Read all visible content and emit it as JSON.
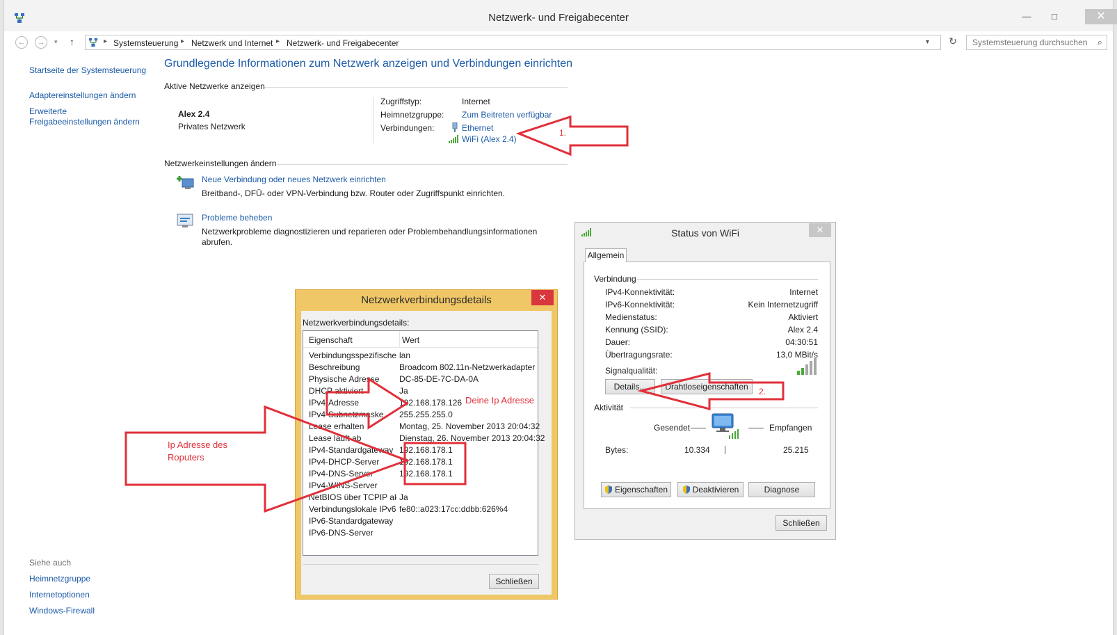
{
  "window": {
    "title": "Netzwerk- und Freigabecenter",
    "minimize": "—",
    "maximize": "□",
    "close": "✕"
  },
  "address": {
    "back": "←",
    "forward": "→",
    "up": "↑",
    "crumbs": [
      "Systemsteuerung",
      "Netzwerk und Internet",
      "Netzwerk- und Freigabecenter"
    ],
    "search_placeholder": "Systemsteuerung durchsuchen"
  },
  "sidebar": {
    "items": [
      {
        "label": "Startseite der Systemsteuerung"
      },
      {
        "label": "Adaptereinstellungen ändern"
      },
      {
        "label": "Erweiterte"
      },
      {
        "label": "Freigabeeinstellungen ändern"
      }
    ],
    "see_also_label": "Siehe auch",
    "see_also": [
      {
        "label": "Heimnetzgruppe"
      },
      {
        "label": "Internetoptionen"
      },
      {
        "label": "Windows-Firewall"
      }
    ]
  },
  "main": {
    "heading": "Grundlegende Informationen zum Netzwerk anzeigen und Verbindungen einrichten",
    "active_networks_label": "Aktive Netzwerke anzeigen",
    "network_name": "Alex 2.4",
    "network_type": "Privates Netzwerk",
    "access_type_label": "Zugriffstyp:",
    "access_type_value": "Internet",
    "homegroup_label": "Heimnetzgruppe:",
    "homegroup_value": "Zum Beitreten verfügbar",
    "connections_label": "Verbindungen:",
    "connection_ethernet": "Ethernet",
    "connection_wifi": "WiFi (Alex 2.4)",
    "change_settings_label": "Netzwerkeinstellungen ändern",
    "new_connection_title": "Neue Verbindung oder neues Netzwerk einrichten",
    "new_connection_desc": "Breitband-, DFÜ- oder VPN-Verbindung bzw. Router oder Zugriffspunkt einrichten.",
    "troubleshoot_title": "Probleme beheben",
    "troubleshoot_desc_1": "Netzwerkprobleme diagnostizieren und reparieren oder Problembehandlungsinformationen",
    "troubleshoot_desc_2": "abrufen."
  },
  "details_dialog": {
    "title": "Netzwerkverbindungsdetails",
    "close": "✕",
    "label": "Netzwerkverbindungsdetails:",
    "col_property": "Eigenschaft",
    "col_value": "Wert",
    "rows": [
      {
        "name": "Verbindungsspezifisches...",
        "value": "lan"
      },
      {
        "name": "Beschreibung",
        "value": "Broadcom 802.11n-Netzwerkadapter"
      },
      {
        "name": "Physische Adresse",
        "value": "DC-85-DE-7C-DA-0A"
      },
      {
        "name": "DHCP aktiviert",
        "value": "Ja"
      },
      {
        "name": "IPv4-Adresse",
        "value": "192.168.178.126"
      },
      {
        "name": "IPv4-Subnetzmaske",
        "value": "255.255.255.0"
      },
      {
        "name": "Lease erhalten",
        "value": "Montag, 25. November 2013 20:04:32"
      },
      {
        "name": "Lease läuft ab",
        "value": "Dienstag, 26. November 2013 20:04:32"
      },
      {
        "name": "IPv4-Standardgateway",
        "value": "192.168.178.1"
      },
      {
        "name": "IPv4-DHCP-Server",
        "value": "192.168.178.1"
      },
      {
        "name": "IPv4-DNS-Server",
        "value": "192.168.178.1"
      },
      {
        "name": "IPv4-WINS-Server",
        "value": ""
      },
      {
        "name": "NetBIOS über TCPIP ak...",
        "value": "Ja"
      },
      {
        "name": "Verbindungslokale IPv6-...",
        "value": "fe80::a023:17cc:ddbb:626%4"
      },
      {
        "name": "IPv6-Standardgateway",
        "value": ""
      },
      {
        "name": "IPv6-DNS-Server",
        "value": ""
      }
    ],
    "close_button": "Schließen"
  },
  "wifi_dialog": {
    "title": "Status von WiFi",
    "close": "✕",
    "tab": "Allgemein",
    "connection_group": "Verbindung",
    "rows": [
      {
        "name": "IPv4-Konnektivität:",
        "value": "Internet"
      },
      {
        "name": "IPv6-Konnektivität:",
        "value": "Kein Internetzugriff"
      },
      {
        "name": "Medienstatus:",
        "value": "Aktiviert"
      },
      {
        "name": "Kennung (SSID):",
        "value": "Alex 2.4"
      },
      {
        "name": "Dauer:",
        "value": "04:30:51"
      },
      {
        "name": "Übertragungsrate:",
        "value": "13,0 MBit/s"
      }
    ],
    "signal_label": "Signalqualität:",
    "details_button": "Details...",
    "wireless_props_button": "Drahtloseigenschaften",
    "activity_group": "Aktivität",
    "sent_label": "Gesendet",
    "received_label": "Empfangen",
    "bytes_label": "Bytes:",
    "bytes_sent": "10.334",
    "bytes_received": "25.215",
    "properties_button": "Eigenschaften",
    "disable_button": "Deaktivieren",
    "diagnose_button": "Diagnose",
    "close_button": "Schließen"
  },
  "annotations": {
    "label_1": "1.",
    "label_2": "2.",
    "ip_label": "Deine Ip Adresse",
    "router_label_1": "Ip Adresse des",
    "router_label_2": "Roputers",
    "color": "#e0303a"
  }
}
